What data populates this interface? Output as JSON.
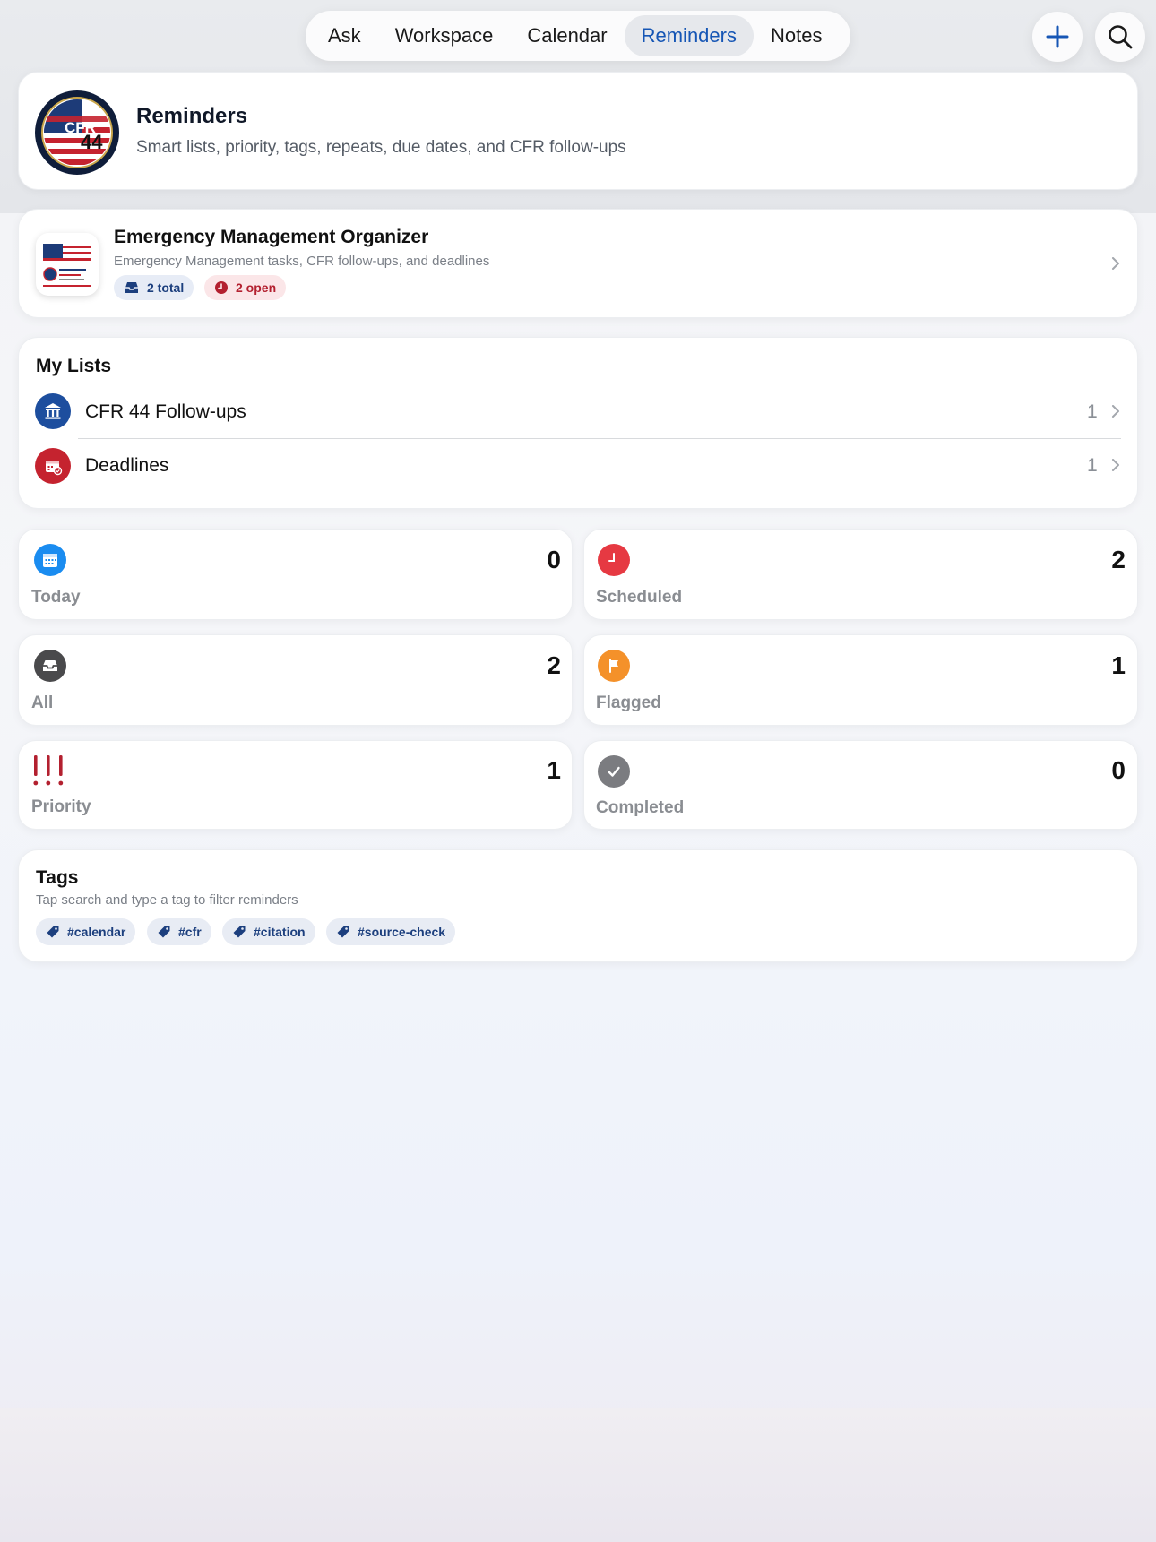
{
  "tabs": [
    {
      "label": "Ask",
      "active": false
    },
    {
      "label": "Workspace",
      "active": false
    },
    {
      "label": "Calendar",
      "active": false
    },
    {
      "label": "Reminders",
      "active": true
    },
    {
      "label": "Notes",
      "active": false
    }
  ],
  "hero": {
    "title": "Reminders",
    "subtitle": "Smart lists, priority, tags, repeats, due dates, and CFR follow-ups",
    "logo_text": "CFR 44"
  },
  "organizer": {
    "title": "Emergency Management Organizer",
    "subtitle": "Emergency Management tasks, CFR follow-ups, and deadlines",
    "total_pill": "2 total",
    "open_pill": "2 open"
  },
  "my_lists": {
    "title": "My Lists",
    "items": [
      {
        "label": "CFR 44 Follow-ups",
        "count": "1",
        "icon": "building-columns-icon",
        "color": "#1d4e9e"
      },
      {
        "label": "Deadlines",
        "count": "1",
        "icon": "calendar-badge-icon",
        "color": "#c5232f"
      }
    ]
  },
  "smart_lists": [
    {
      "label": "Today",
      "count": "0",
      "icon": "calendar-icon",
      "color": "#1a8cf0"
    },
    {
      "label": "Scheduled",
      "count": "2",
      "icon": "clock-icon",
      "color": "#e63942"
    },
    {
      "label": "All",
      "count": "2",
      "icon": "tray-icon",
      "color": "#4a4a4c"
    },
    {
      "label": "Flagged",
      "count": "1",
      "icon": "flag-icon",
      "color": "#f4912a"
    },
    {
      "label": "Priority",
      "count": "1",
      "icon": "exclamation-icon",
      "color": "#b3202f"
    },
    {
      "label": "Completed",
      "count": "0",
      "icon": "checkmark-icon",
      "color": "#7b7c80"
    }
  ],
  "tags": {
    "title": "Tags",
    "subtitle": "Tap search and type a tag to filter reminders",
    "items": [
      "#calendar",
      "#cfr",
      "#citation",
      "#source-check"
    ]
  },
  "colors": {
    "accent": "#1656b5",
    "navy": "#1c3f7e",
    "red": "#b3202f"
  }
}
